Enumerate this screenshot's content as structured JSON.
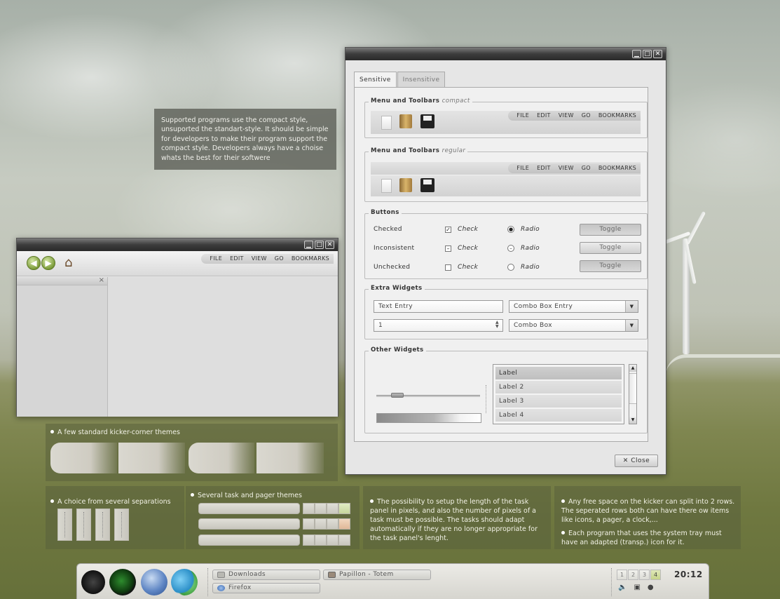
{
  "info_text": "Supported programs use the compact style, unsuported the standart-style. It should be simple for developers to make their program support the compact style. Developers always have a choise whats the best for their softwere",
  "menu": [
    "FILE",
    "EDIT",
    "VIEW",
    "GO",
    "BOOKMARKS"
  ],
  "browser": {
    "back_symbol": "◀",
    "forward_symbol": "▶",
    "home_symbol": "⌂",
    "sidebar_close": "×"
  },
  "window_buttons": {
    "minimize": "▁",
    "maximize": "□",
    "close": "✕"
  },
  "dialog": {
    "tabs": [
      "Sensitive",
      "Insensitive"
    ],
    "frames": {
      "menu_compact": {
        "title": "Menu and Toolbars",
        "style": "compact"
      },
      "menu_regular": {
        "title": "Menu and Toolbars",
        "style": "regular"
      },
      "buttons": "Buttons",
      "extra": "Extra Widgets",
      "other": "Other Widgets"
    },
    "button_rows": [
      {
        "label": "Checked",
        "check": "Check",
        "radio": "Radio",
        "toggle": "Toggle",
        "check_mark": "✓",
        "radio_mark": "●"
      },
      {
        "label": "Inconsistent",
        "check": "Check",
        "radio": "Radio",
        "toggle": "Toggle",
        "check_mark": "–",
        "radio_mark": "–"
      },
      {
        "label": "Unchecked",
        "check": "Check",
        "radio": "Radio",
        "toggle": "Toggle",
        "check_mark": "",
        "radio_mark": ""
      }
    ],
    "text_entry": "Text Entry",
    "combo_entry": "Combo Box Entry",
    "spin_value": "1",
    "combo_box": "Combo Box",
    "combo_arrow": "▼",
    "spin_arrows": "▲▼",
    "slider_value": 0.2,
    "progress_value": 0.6,
    "list_items": [
      "Label",
      "Label 2",
      "Label 3",
      "Label 4"
    ],
    "scroll_up": "▲",
    "scroll_down": "▼",
    "close_label": "Close",
    "close_icon": "✕"
  },
  "panels": {
    "corner_themes": "A few standard kicker-corner themes",
    "separations": "A choice from several separations",
    "task_pager": "Several task and pager themes",
    "task_length": "The possibility to setup the length of the task panel in pixels, and also the number of pixels of a task must be possible. The tasks should adapt automatically if they are no longer appropriate for the task panel's lenght.",
    "free_space": "Any free space  on the kicker can split into 2 rows.  The seperated rows both can have there ow items like icons, a pager, a clock,...",
    "systray": "Each program that uses the system tray must have an adapted (transp.) icon for it."
  },
  "kicker": {
    "tasks": [
      "Downloads",
      "Papillon - Totem",
      "Firefox"
    ],
    "pager": [
      "1",
      "2",
      "3",
      "4"
    ],
    "active_desktop": "4",
    "clock": "20:12",
    "tray_icons": [
      "speaker-icon",
      "battery-icon",
      "user-icon"
    ],
    "tray_symbols": [
      "🔈",
      "▣",
      "●"
    ]
  },
  "colors": {
    "accent_green": "#7c9c3a",
    "titlebar": "#3c3c3c",
    "pager_active": "#c6d48a"
  }
}
